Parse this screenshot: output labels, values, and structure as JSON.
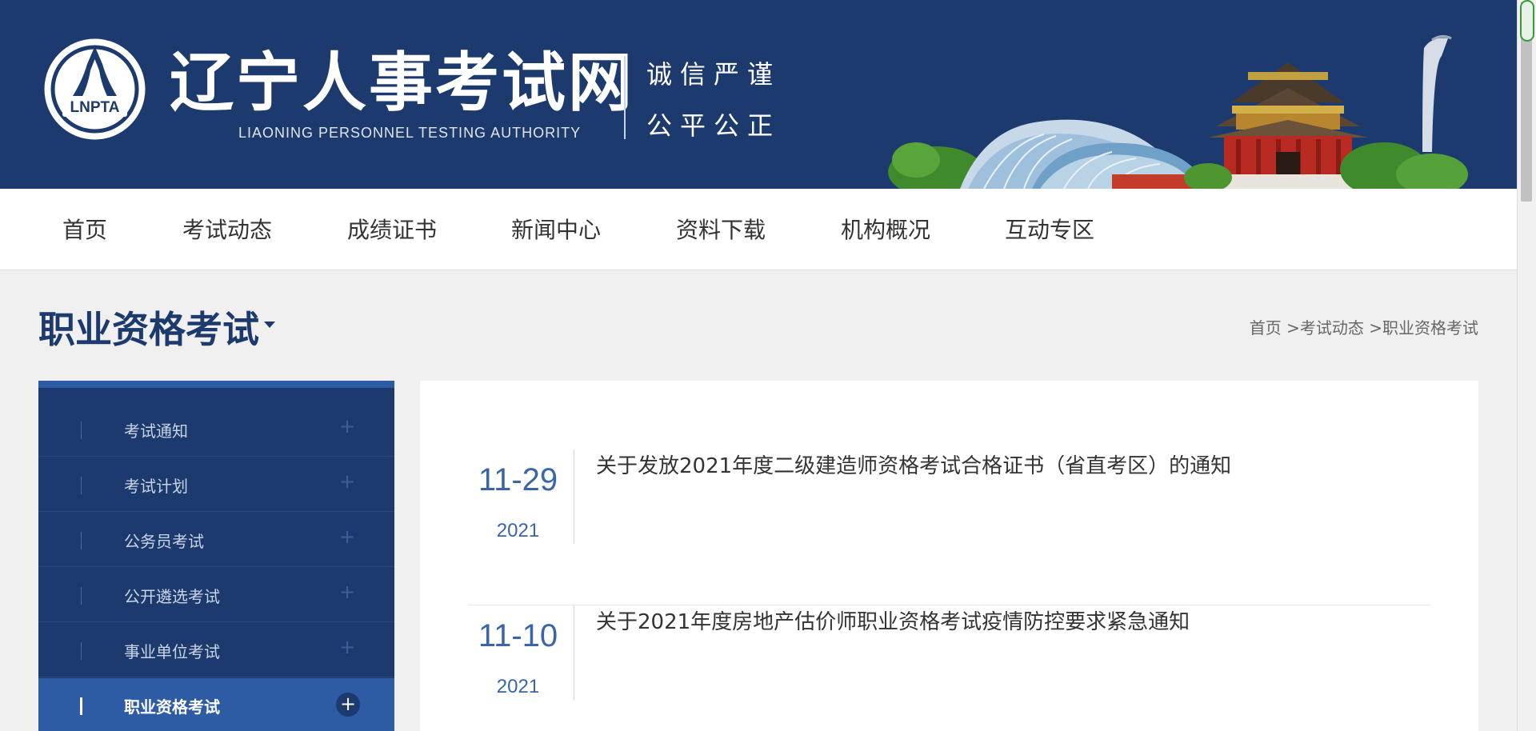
{
  "header": {
    "logo_text": "LNPTA",
    "title": "辽宁人事考试网",
    "subtitle": "LIAONING PERSONNEL TESTING AUTHORITY",
    "motto_line1": "诚信严谨",
    "motto_line2": "公平公正"
  },
  "nav": {
    "items": [
      {
        "label": "首页"
      },
      {
        "label": "考试动态"
      },
      {
        "label": "成绩证书"
      },
      {
        "label": "新闻中心"
      },
      {
        "label": "资料下载"
      },
      {
        "label": "机构概况"
      },
      {
        "label": "互动专区"
      }
    ]
  },
  "page": {
    "title": "职业资格考试",
    "breadcrumb": [
      "首页",
      "考试动态",
      "职业资格考试"
    ],
    "breadcrumb_sep": ">"
  },
  "sidebar": {
    "items": [
      {
        "label": "考试通知",
        "active": false
      },
      {
        "label": "考试计划",
        "active": false
      },
      {
        "label": "公务员考试",
        "active": false
      },
      {
        "label": "公开遴选考试",
        "active": false
      },
      {
        "label": "事业单位考试",
        "active": false
      },
      {
        "label": "职业资格考试",
        "active": true
      }
    ],
    "plus_symbol": "+"
  },
  "news": [
    {
      "date": "11-29",
      "year": "2021",
      "title": "关于发放2021年度二级建造师资格考试合格证书（省直考区）的通知"
    },
    {
      "date": "11-10",
      "year": "2021",
      "title": "关于2021年度房地产估价师职业资格考试疫情防控要求紧急通知"
    }
  ],
  "colors": {
    "brand_dark": "#1d3a6e",
    "brand_accent": "#2d5ba4",
    "date_blue": "#3a65a8"
  }
}
